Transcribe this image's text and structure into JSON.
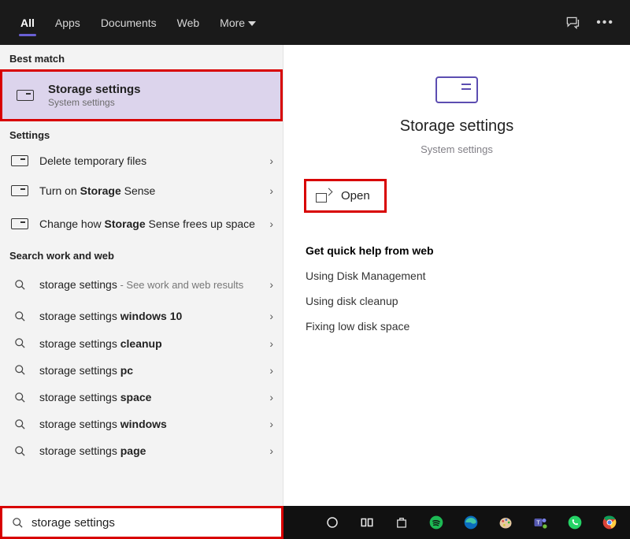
{
  "topbar": {
    "tabs": [
      "All",
      "Apps",
      "Documents",
      "Web",
      "More"
    ]
  },
  "sections": {
    "best_match": "Best match",
    "settings": "Settings",
    "search_web": "Search work and web"
  },
  "best_match_item": {
    "title": "Storage settings",
    "subtitle": "System settings"
  },
  "settings_items": [
    {
      "title": "Delete temporary files",
      "bold_after": ""
    },
    {
      "title_pre": "Turn on ",
      "bold": "Storage",
      "title_post": " Sense"
    },
    {
      "title_pre": "Change how ",
      "bold": "Storage",
      "title_post": " Sense frees up space"
    }
  ],
  "web_items": [
    {
      "pre": "storage settings",
      "dim": " - See work and web results",
      "bold": ""
    },
    {
      "pre": "storage settings ",
      "bold": "windows 10"
    },
    {
      "pre": "storage settings ",
      "bold": "cleanup"
    },
    {
      "pre": "storage settings ",
      "bold": "pc"
    },
    {
      "pre": "storage settings ",
      "bold": "space"
    },
    {
      "pre": "storage settings ",
      "bold": "windows"
    },
    {
      "pre": "storage settings ",
      "bold": "page"
    }
  ],
  "preview": {
    "title": "Storage settings",
    "subtitle": "System settings",
    "open_label": "Open",
    "quick_help_header": "Get quick help from web",
    "links": [
      "Using Disk Management",
      "Using disk cleanup",
      "Fixing low disk space"
    ]
  },
  "search": {
    "query": "storage settings"
  },
  "colors": {
    "accent": "#5c4db1",
    "highlight": "#d80000",
    "selection": "#dcd4ec"
  }
}
